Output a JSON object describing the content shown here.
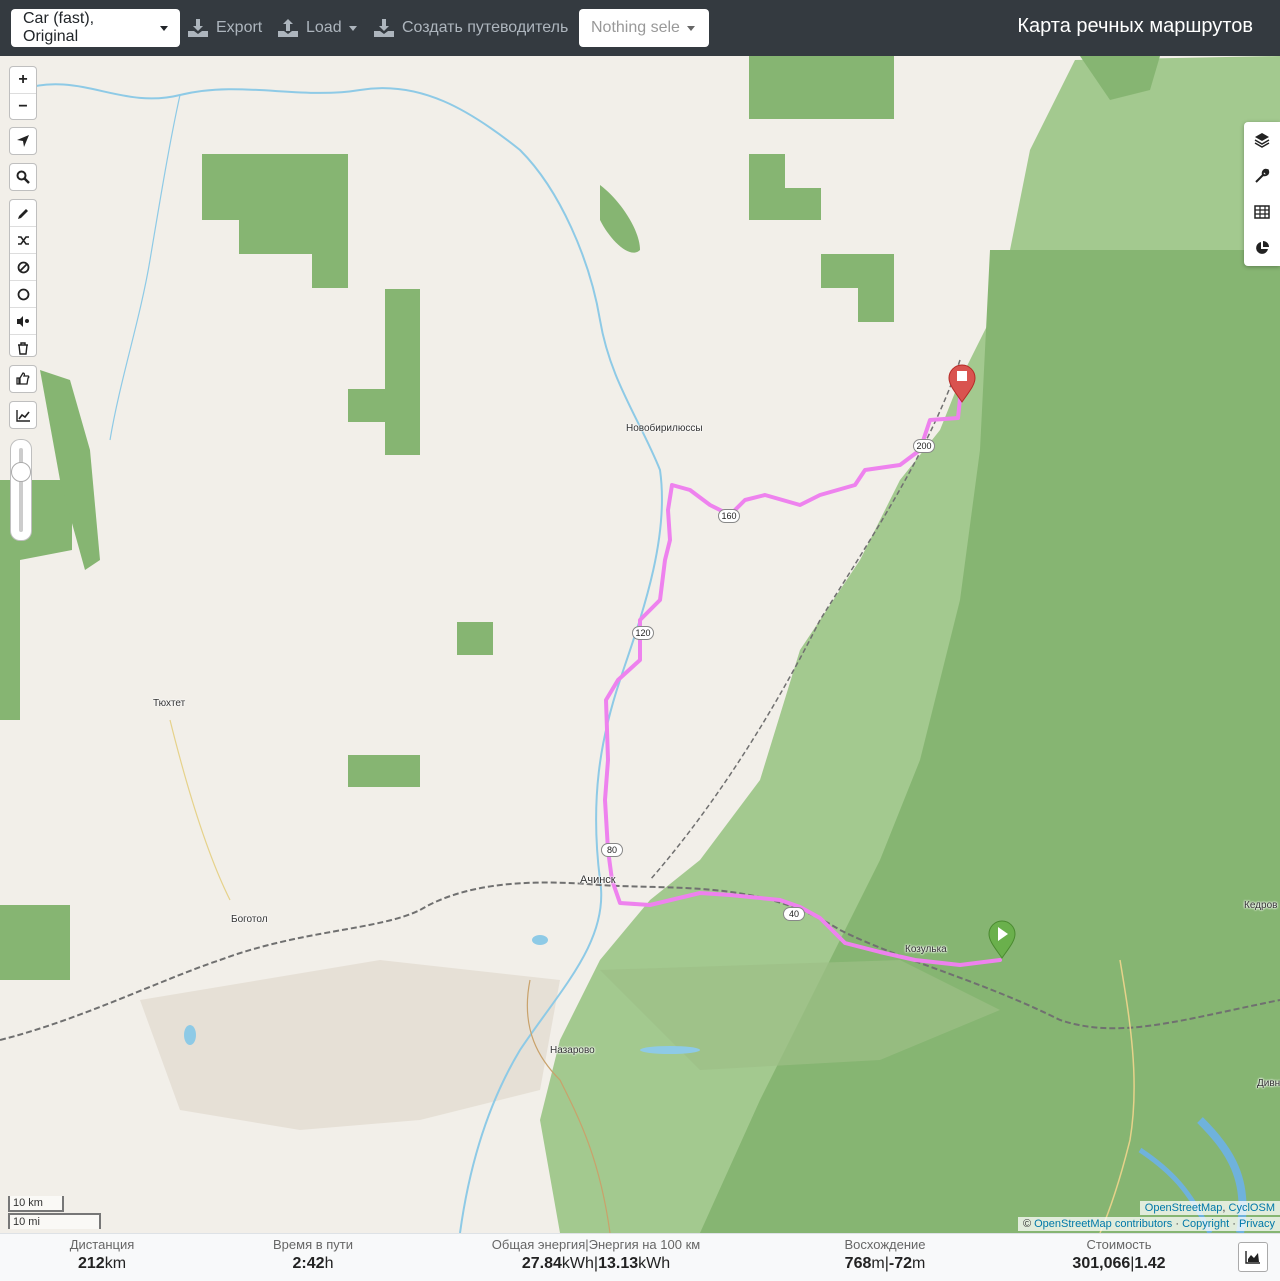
{
  "header": {
    "profile_label": "Car (fast), Original",
    "export_label": "Export",
    "load_label": "Load",
    "guide_label": "Создать путеводитель",
    "selection_label": "Nothing sele",
    "brand": "Карта речных маршрутов"
  },
  "map": {
    "places": {
      "novobiriussy": "Новобирилюссы",
      "tyukhtet": "Тюхтет",
      "achinsk": "Ачинск",
      "bogotol": "Боготол",
      "kozulka": "Козулька",
      "nazarovo": "Назарово",
      "kedrovy": "Кедров",
      "divn": "Дивн"
    },
    "road_shields": [
      "200",
      "160",
      "120",
      "80",
      "40"
    ],
    "scale": {
      "km": "10 km",
      "mi": "10 mi"
    },
    "attribution": {
      "line1_a": "OpenStreetMap",
      "line1_sep": ", ",
      "line1_b": "CyclOSM",
      "line2_prefix": "© ",
      "line2_a": "OpenStreetMap contributors",
      "line2_sep1": " · ",
      "line2_b": "Copyright",
      "line2_sep2": " · ",
      "line2_c": "Privacy"
    },
    "route_color": "#ee82ee",
    "start_marker_color": "#6ab04c",
    "end_marker_color": "#d9534f"
  },
  "controls": {
    "zoom_in": "+",
    "zoom_out": "−",
    "left_icons": [
      "locate-icon",
      "search-icon",
      "pencil-icon",
      "shuffle-icon",
      "no-entry-icon",
      "circle-icon",
      "pin-sound-icon",
      "trash-icon",
      "thumb-icon",
      "chart-icon"
    ],
    "right_icons": [
      "layers-icon",
      "wrench-icon",
      "table-icon",
      "pie-chart-icon"
    ]
  },
  "footer": {
    "distance": {
      "title": "Дистанция",
      "value": "212",
      "unit": "km"
    },
    "time": {
      "title": "Время в пути",
      "value": "2:42",
      "unit": "h"
    },
    "energy": {
      "title": "Общая энергия|Энергия на 100 км",
      "value1": "27.84",
      "unit1": "kWh",
      "sep": "|",
      "value2": "13.13",
      "unit2": "kWh"
    },
    "ascent": {
      "title": "Восхождение",
      "value1": "768",
      "unit1": "m",
      "sep": "|",
      "value2": "-72",
      "unit2": "m"
    },
    "cost": {
      "title": "Стоимость",
      "value1": "301,066",
      "sep": "|",
      "value2": "1.42"
    }
  }
}
